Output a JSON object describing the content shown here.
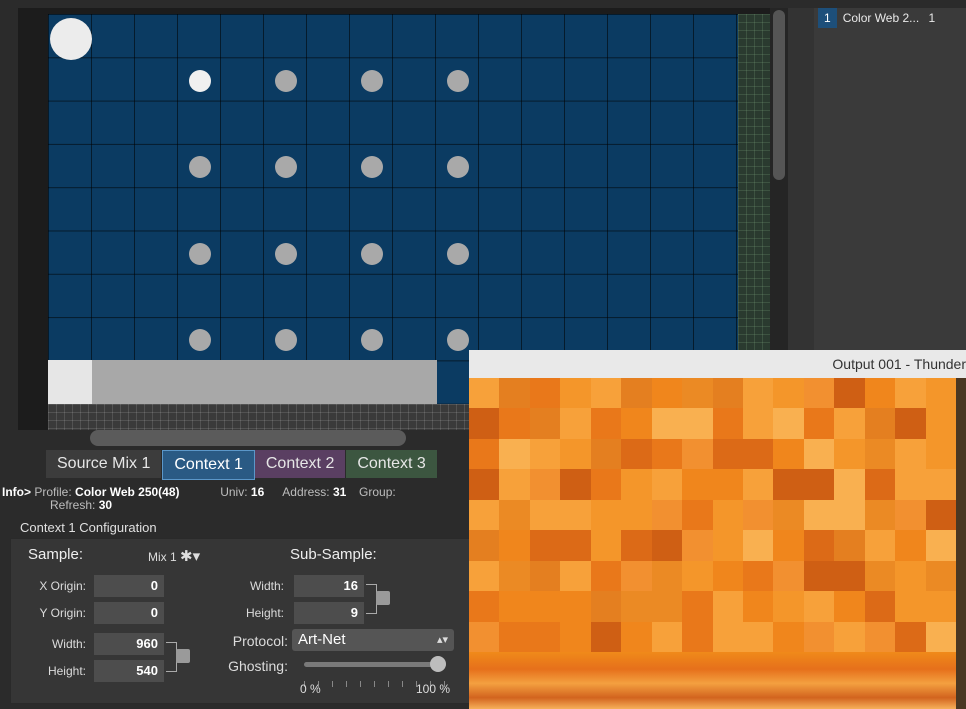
{
  "right_panel": {
    "row_number": "1",
    "row_name": "Color Web 2...",
    "row_extra": "1"
  },
  "tabs": [
    {
      "label": "Source Mix 1"
    },
    {
      "label": "Context 1"
    },
    {
      "label": "Context 2"
    },
    {
      "label": "Context 3"
    }
  ],
  "info": {
    "prefix": "Info>",
    "profile_label": "Profile:",
    "profile_value": "Color Web 250(48)",
    "univ_label": "Univ:",
    "univ_value": "16",
    "address_label": "Address:",
    "address_value": "31",
    "group_label": "Group:",
    "refresh_label": "Refresh:",
    "refresh_value": "30"
  },
  "config": {
    "title": "Context 1 Configuration",
    "sample_label": "Sample:",
    "sample_value": "Mix 1",
    "subsample_label": "Sub-Sample:",
    "x_origin_label": "X Origin:",
    "x_origin_value": "0",
    "y_origin_label": "Y Origin:",
    "y_origin_value": "0",
    "width_label": "Width:",
    "width_value": "960",
    "height_label": "Height:",
    "height_value": "540",
    "sub_width_label": "Width:",
    "sub_width_value": "16",
    "sub_height_label": "Height:",
    "sub_height_value": "9",
    "protocol_label": "Protocol:",
    "protocol_value": "Art-Net",
    "ghosting_label": "Ghosting:",
    "ghosting_min": "0 %",
    "ghosting_max": "100 %",
    "ghosting_level_percent": 95
  },
  "output_window": {
    "title": "Output 001 - Thunder"
  },
  "colors": {
    "grid_blue": "#0b3b62",
    "tab_active": "#2a5a84",
    "tab_context2": "#5a3f62",
    "tab_context3": "#3c5640"
  },
  "icons": {
    "sample_gear": "gear-icon",
    "lock": "lock-icon"
  }
}
